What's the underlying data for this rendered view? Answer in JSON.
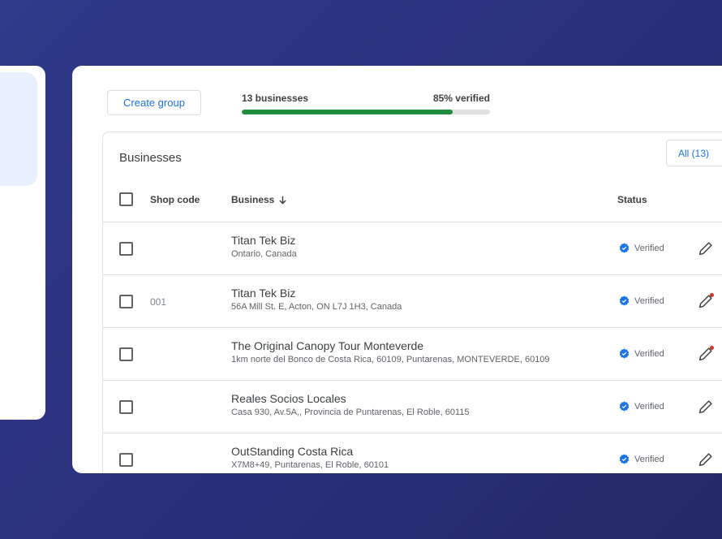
{
  "toolbar": {
    "create_group_label": "Create group",
    "business_count": "13 businesses",
    "verified_percent_label": "85% verified",
    "verified_fraction": 0.85
  },
  "table": {
    "title": "Businesses",
    "filter_label": "All (13)",
    "columns": {
      "shop_code": "Shop code",
      "business": "Business",
      "status": "Status"
    },
    "rows": [
      {
        "shop_code": "",
        "name": "Titan Tek Biz",
        "address": "Ontario, Canada",
        "status": "Verified",
        "edit_notification": false
      },
      {
        "shop_code": "001",
        "name": "Titan Tek Biz",
        "address": "56A Mill St. E, Acton, ON L7J 1H3, Canada",
        "status": "Verified",
        "edit_notification": true
      },
      {
        "shop_code": "",
        "name": "The Original Canopy Tour Monteverde",
        "address": "1km norte del Bonco de Costa Rica, 60109, Puntarenas, MONTEVERDE, 60109",
        "status": "Verified",
        "edit_notification": true
      },
      {
        "shop_code": "",
        "name": "Reales Socios Locales",
        "address": "Casa 930, Av.5A,, Provincia de Puntarenas, El Roble, 60115",
        "status": "Verified",
        "edit_notification": false
      },
      {
        "shop_code": "",
        "name": "OutStanding Costa Rica",
        "address": "X7M8+49, Puntarenas, El Roble, 60101",
        "status": "Verified",
        "edit_notification": false
      }
    ]
  },
  "icons": {
    "sort": "arrow-down-icon",
    "verified": "verified-badge-icon",
    "edit": "pencil-icon"
  },
  "colors": {
    "background": "#2a2f7a",
    "accent": "#1a73e8",
    "progress": "#1e8e3e",
    "notification_dot": "#d93025"
  }
}
